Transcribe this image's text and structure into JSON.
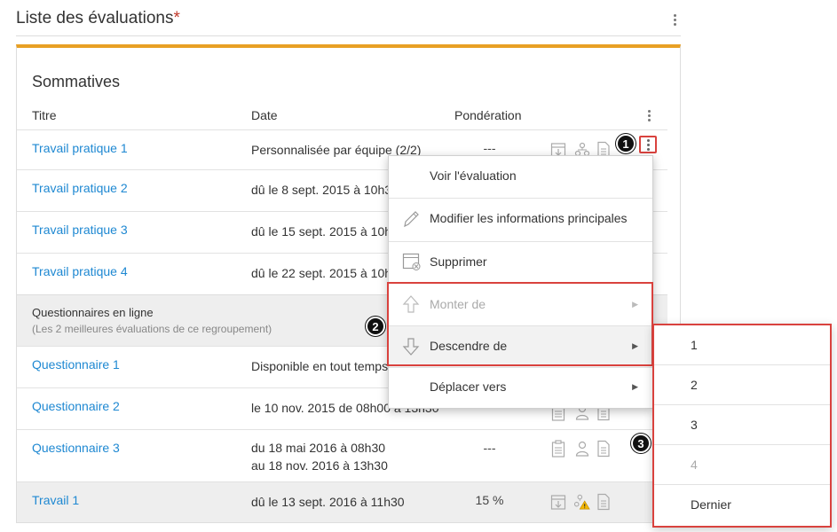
{
  "page": {
    "title": "Liste des évaluations",
    "required_mark": "*"
  },
  "section": {
    "title": "Sommatives"
  },
  "table": {
    "headers": {
      "titre": "Titre",
      "date": "Date",
      "ponderation": "Pondération"
    },
    "rows": [
      {
        "title": "Travail pratique 1",
        "date": "Personnalisée par équipe (2/2)",
        "ponderation": "---"
      },
      {
        "title": "Travail pratique 2",
        "date": "dû le 8 sept. 2015 à 10h30"
      },
      {
        "title": "Travail pratique 3",
        "date": "dû le 15 sept. 2015 à 10h3"
      },
      {
        "title": "Travail pratique 4",
        "date": "dû le 22 sept. 2015 à 10h3"
      }
    ],
    "group": {
      "title": "Questionnaires en ligne",
      "subtitle": "(Les 2 meilleures évaluations de ce regroupement)"
    },
    "group_rows": [
      {
        "title": "Questionnaire 1",
        "date": "Disponible en tout temps"
      },
      {
        "title": "Questionnaire 2",
        "date": "le 10 nov. 2015 de 08h00 à 13h30"
      },
      {
        "title": "Questionnaire 3",
        "date_line1": "du 18 mai 2016 à 08h30",
        "date_line2": "au 18 nov. 2016 à 13h30",
        "ponderation": "---"
      }
    ],
    "last_row": {
      "title": "Travail 1",
      "date": "dû le 13 sept. 2016 à 11h30",
      "ponderation": "15 %"
    }
  },
  "menu": {
    "items": [
      {
        "label": "Voir l'évaluation"
      },
      {
        "label": "Modifier les informations principales",
        "icon": "pencil-icon"
      },
      {
        "label": "Supprimer",
        "icon": "delete-icon"
      },
      {
        "label": "Monter de",
        "icon": "arrow-up-icon",
        "disabled": true
      },
      {
        "label": "Descendre de",
        "icon": "arrow-down-icon"
      },
      {
        "label": "Déplacer vers"
      }
    ]
  },
  "submenu": {
    "items": [
      "1",
      "2",
      "3",
      "4",
      "Dernier"
    ]
  },
  "badges": [
    "1",
    "2",
    "3"
  ],
  "colors": {
    "accent": "#e8a024",
    "link": "#1e88d2",
    "highlight": "#d9423e",
    "warning": "#f5b800"
  }
}
